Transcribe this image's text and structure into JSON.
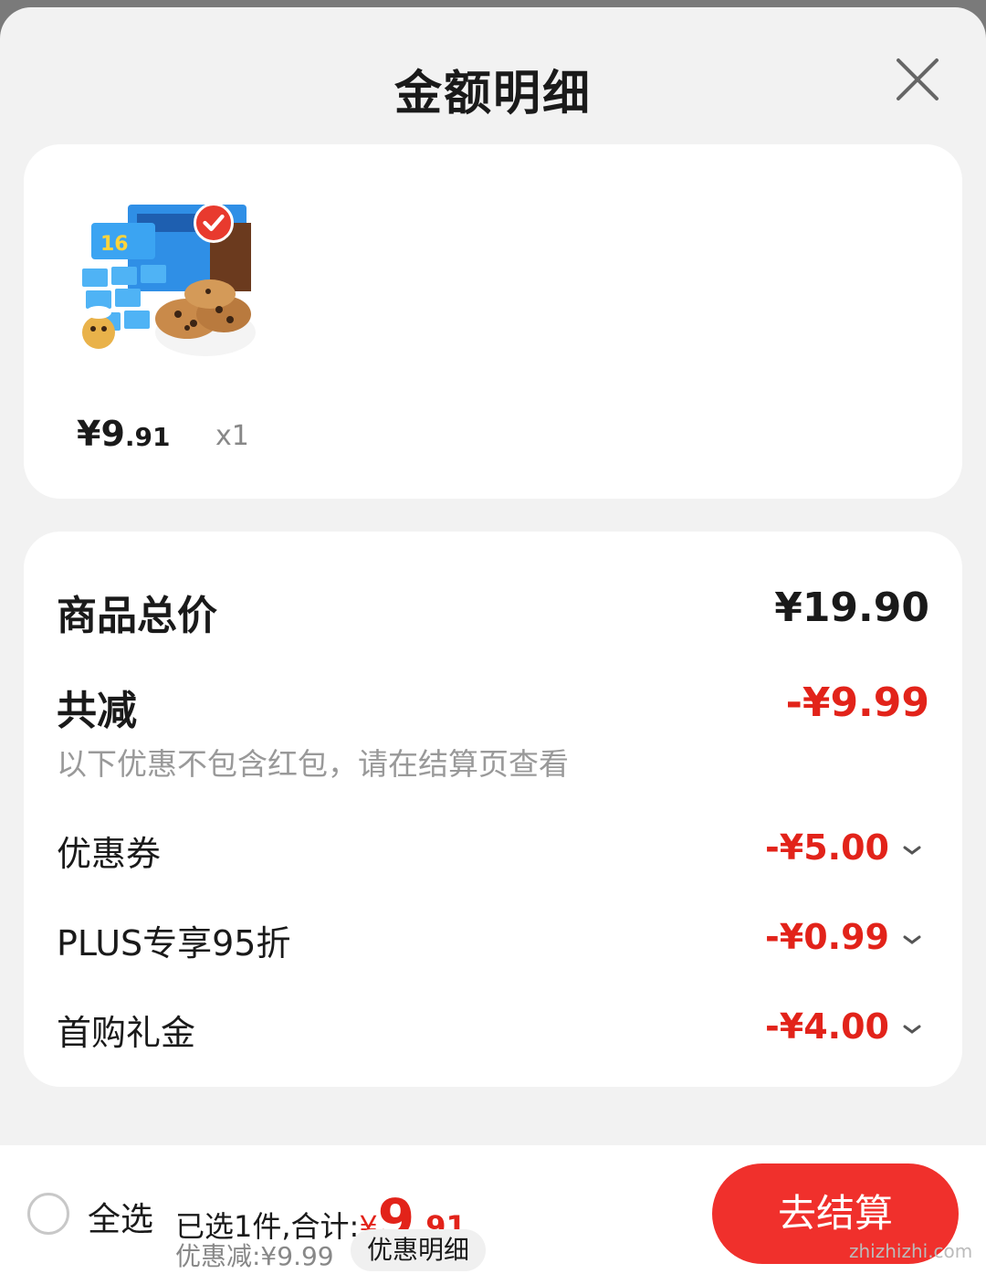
{
  "header": {
    "title": "金额明细"
  },
  "product": {
    "price_integer": "¥9",
    "price_decimal": ".91",
    "quantity": "x1",
    "selected": true
  },
  "details": {
    "total_label": "商品总价",
    "total_value": "¥19.90",
    "discount_label": "共减",
    "discount_value": "-¥9.99",
    "note": "以下优惠不包含红包，请在结算页查看",
    "items": [
      {
        "label": "优惠券",
        "value": "-¥5.00"
      },
      {
        "label": "PLUS专享95折",
        "value": "-¥0.99"
      },
      {
        "label": "首购礼金",
        "value": "-¥4.00"
      }
    ]
  },
  "footer": {
    "select_all": "全选",
    "summary_prefix": "已选1件,合计:",
    "total_yen": "¥",
    "total_integer": "9",
    "total_decimal": ".91",
    "saved": "优惠减:¥9.99",
    "detail_button": "优惠明细",
    "checkout_button": "去结算",
    "watermark": "zhizhizhi.com"
  },
  "colors": {
    "accent": "#e2231a",
    "checkout": "#f0302c",
    "background": "#f2f2f2"
  }
}
